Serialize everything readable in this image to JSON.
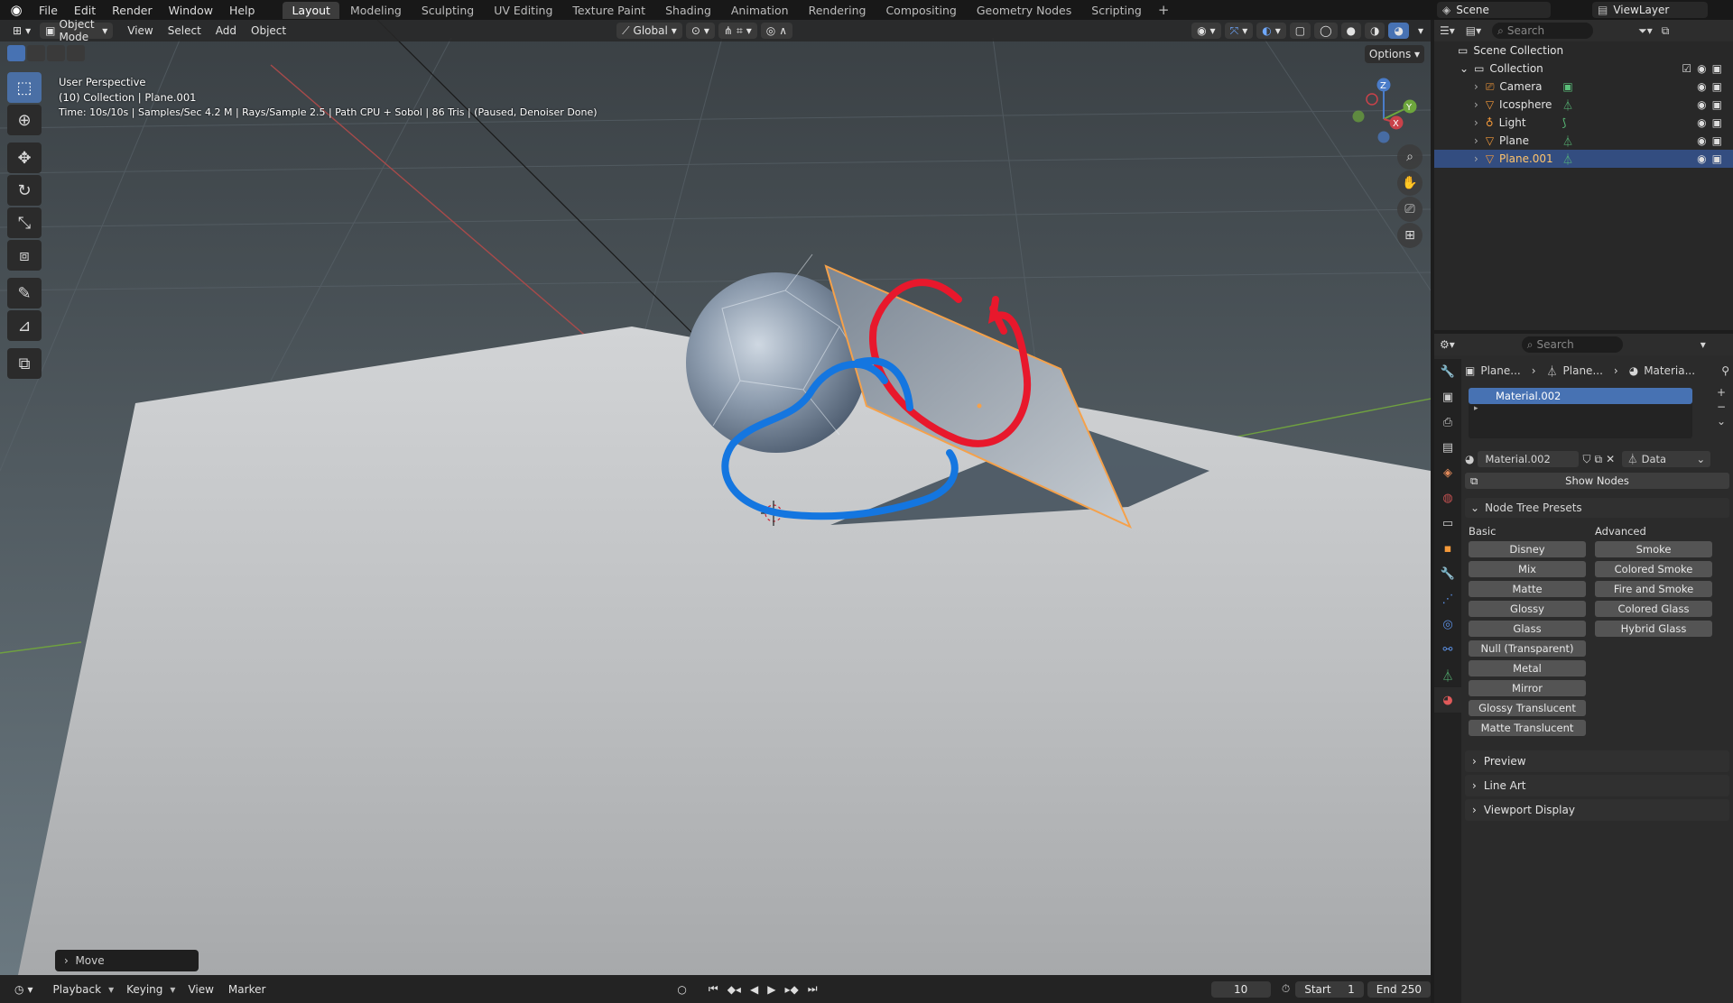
{
  "menu": [
    "File",
    "Edit",
    "Render",
    "Window",
    "Help"
  ],
  "workspaces": [
    {
      "label": "Layout",
      "active": true
    },
    {
      "label": "Modeling"
    },
    {
      "label": "Sculpting"
    },
    {
      "label": "UV Editing"
    },
    {
      "label": "Texture Paint"
    },
    {
      "label": "Shading"
    },
    {
      "label": "Animation"
    },
    {
      "label": "Rendering"
    },
    {
      "label": "Compositing"
    },
    {
      "label": "Geometry Nodes"
    },
    {
      "label": "Scripting"
    }
  ],
  "top_right": {
    "scene": "Scene",
    "view_layer": "ViewLayer"
  },
  "viewport": {
    "mode": "Object Mode",
    "menus": [
      "View",
      "Select",
      "Add",
      "Object"
    ],
    "orientation": "Global",
    "options": "Options",
    "info_line1": "User Perspective",
    "info_line2": "(10) Collection | Plane.001",
    "info_line3": "Time: 10s/10s | Samples/Sec 4.2 M | Rays/Sample 2.5 | Path CPU + Sobol | 86 Tris | (Paused, Denoiser Done)",
    "gizmo": {
      "z": "Z",
      "y": "Y",
      "x": "X"
    },
    "last_op": "Move"
  },
  "timeline": {
    "menus": [
      "Playback",
      "Keying",
      "View",
      "Marker"
    ],
    "current_frame": "10",
    "start_label": "Start",
    "start": "1",
    "end_label": "End",
    "end": "250"
  },
  "outliner": {
    "search": "Search",
    "root": "Scene Collection",
    "collection": "Collection",
    "items": [
      {
        "name": "Camera"
      },
      {
        "name": "Icosphere"
      },
      {
        "name": "Light"
      },
      {
        "name": "Plane"
      },
      {
        "name": "Plane.001",
        "selected": true
      }
    ]
  },
  "properties": {
    "search": "Search",
    "breadcrumb": [
      "Plane...",
      "Plane...",
      "Materia..."
    ],
    "slot": "Material.002",
    "material_name": "Material.002",
    "link": "Data",
    "show_nodes": "Show Nodes",
    "presets_title": "Node Tree Presets",
    "basic_label": "Basic",
    "advanced_label": "Advanced",
    "basic": [
      "Disney",
      "Mix",
      "Matte",
      "Glossy",
      "Glass",
      "Null (Transparent)",
      "Metal",
      "Mirror",
      "Glossy Translucent",
      "Matte Translucent"
    ],
    "advanced": [
      "Smoke",
      "Colored Smoke",
      "Fire and Smoke",
      "Colored Glass",
      "Hybrid Glass"
    ],
    "sections": [
      "Preview",
      "Line Art",
      "Viewport Display"
    ]
  },
  "colors": {
    "accent": "#4772b3",
    "selection_orange": "#f5a14a",
    "annotation_red": "#e8182c",
    "annotation_blue": "#1476e0"
  }
}
